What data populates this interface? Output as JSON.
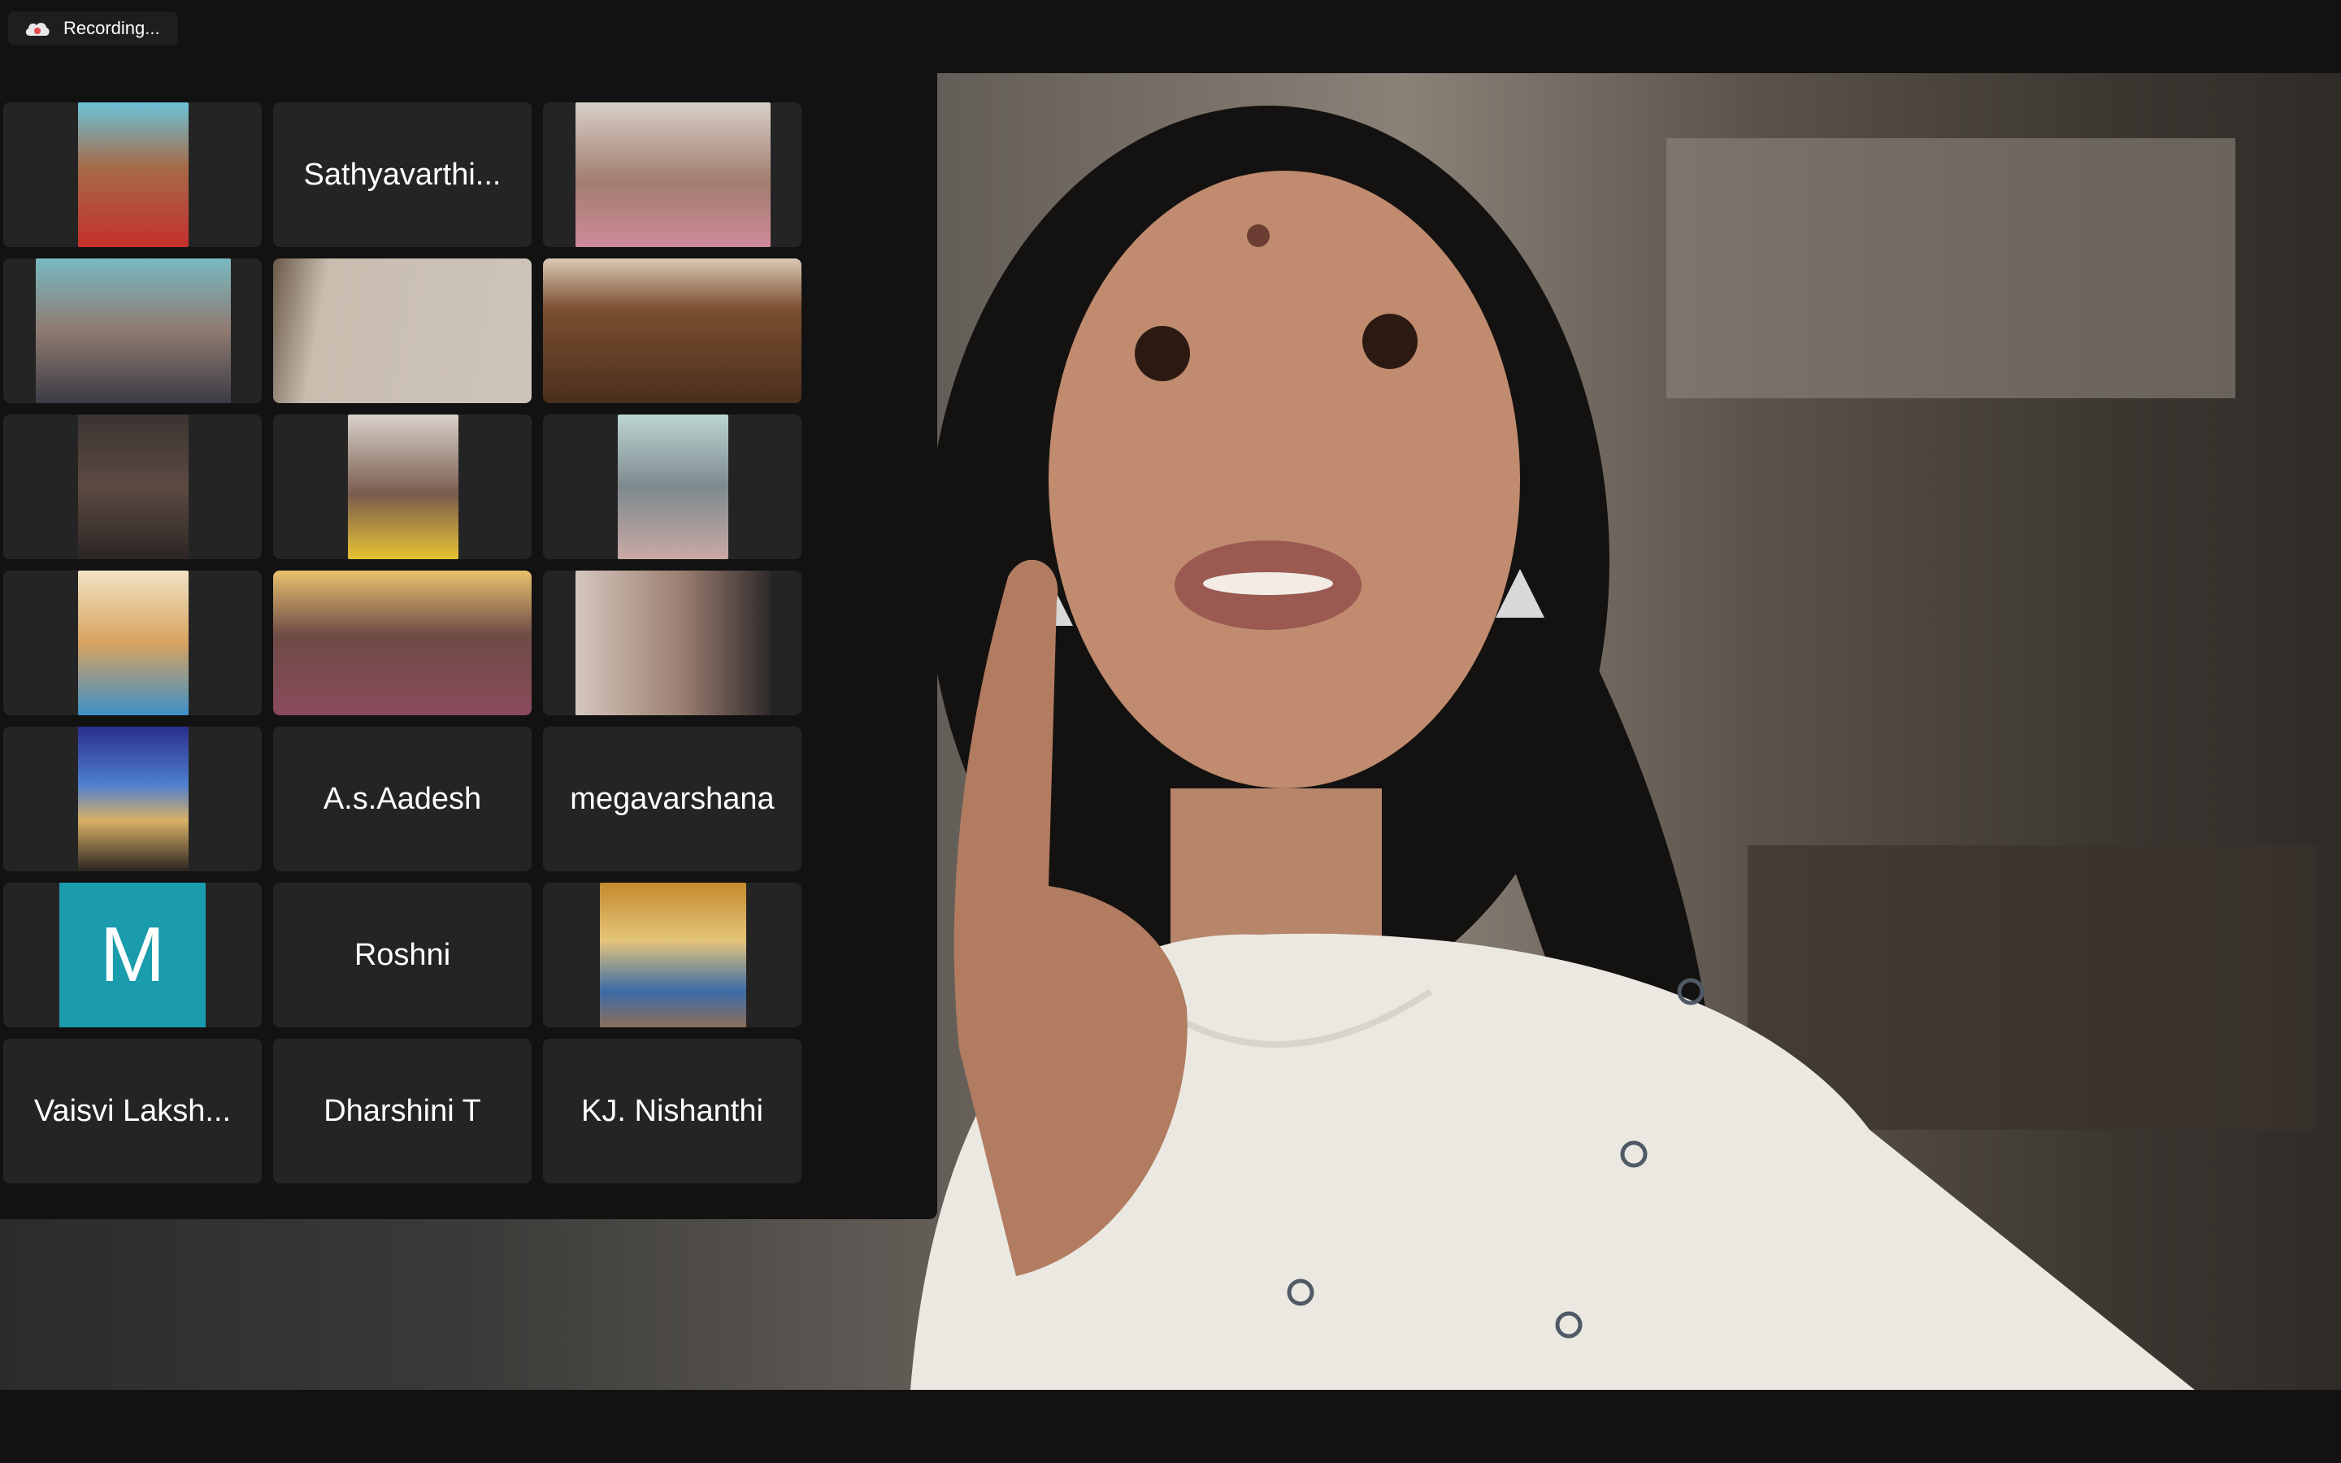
{
  "recording": {
    "label": "Recording...",
    "icon": "cloud-recording-icon"
  },
  "gallery": {
    "participants": [
      {
        "name": "",
        "video": true
      },
      {
        "name": "Sathyavarthi...",
        "video": false
      },
      {
        "name": "",
        "video": true
      },
      {
        "name": "",
        "video": true
      },
      {
        "name": "",
        "video": true
      },
      {
        "name": "",
        "video": true
      },
      {
        "name": "",
        "video": true
      },
      {
        "name": "",
        "video": true
      },
      {
        "name": "",
        "video": true
      },
      {
        "name": "",
        "video": true
      },
      {
        "name": "",
        "video": true
      },
      {
        "name": "",
        "video": true
      },
      {
        "name": "",
        "video": true
      },
      {
        "name": "A.s.Aadesh",
        "video": false
      },
      {
        "name": "megavarshana",
        "video": false
      },
      {
        "name": "M",
        "video": false,
        "avatar_color": "#1a9cad"
      },
      {
        "name": "Roshni",
        "video": false
      },
      {
        "name": "",
        "video": true
      },
      {
        "name": "Vaisvi Laksh...",
        "video": false
      },
      {
        "name": "Dharshini T",
        "video": false
      },
      {
        "name": "KJ. Nishanthi",
        "video": false
      }
    ]
  }
}
